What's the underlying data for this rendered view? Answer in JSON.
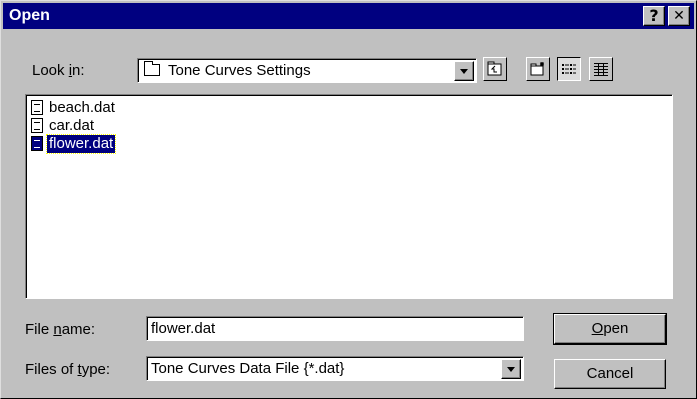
{
  "window": {
    "title": "Open",
    "help_glyph": "?",
    "close_glyph": "✕"
  },
  "look_in": {
    "label_pre": "Look ",
    "label_ul": "i",
    "label_post": "n:",
    "value": "Tone Curves Settings",
    "icon": "folder-icon"
  },
  "toolbar": {
    "items": [
      "up-one-level-icon",
      "create-new-folder-icon",
      "list-view-icon",
      "details-view-icon"
    ]
  },
  "files": [
    {
      "name": "beach.dat",
      "selected": false
    },
    {
      "name": "car.dat",
      "selected": false
    },
    {
      "name": "flower.dat",
      "selected": true
    }
  ],
  "file_name": {
    "label_pre": "File ",
    "label_ul": "n",
    "label_post": "ame:",
    "value": "flower.dat"
  },
  "file_type": {
    "label_pre": "Files of ",
    "label_ul": "t",
    "label_post": "ype:",
    "value": "Tone Curves Data File {*.dat}"
  },
  "buttons": {
    "open_ul": "O",
    "open_rest": "pen",
    "cancel": "Cancel"
  },
  "colors": {
    "titlebar": "#000080",
    "face": "#c0c0c0",
    "selection": "#000080"
  }
}
